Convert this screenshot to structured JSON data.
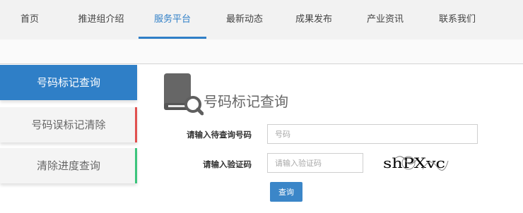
{
  "nav": {
    "items": [
      {
        "label": "首页"
      },
      {
        "label": "推进组介绍"
      },
      {
        "label": "服务平台"
      },
      {
        "label": "最新动态"
      },
      {
        "label": "成果发布"
      },
      {
        "label": "产业资讯"
      },
      {
        "label": "联系我们"
      }
    ],
    "active_index": 2
  },
  "sidebar": {
    "items": [
      {
        "label": "号码标记查询",
        "active": true
      },
      {
        "label": "号码误标记清除",
        "accent_color": "#e0514f"
      },
      {
        "label": "清除进度查询",
        "accent_color": "#3cc47c"
      }
    ]
  },
  "panel": {
    "title": "号码标记查询",
    "icon": "book-search-icon",
    "form": {
      "number_label": "请输入待查询号码",
      "number_placeholder": "号码",
      "captcha_label": "请输入验证码",
      "captcha_placeholder": "请输入验证码",
      "captcha_text": "shPXvc",
      "submit_label": "查询"
    }
  },
  "colors": {
    "accent": "#2f7fc7",
    "nav_bg": "#f2f2f2",
    "sidebar_inactive": "#f4f4f4",
    "button": "#3b86c8"
  }
}
